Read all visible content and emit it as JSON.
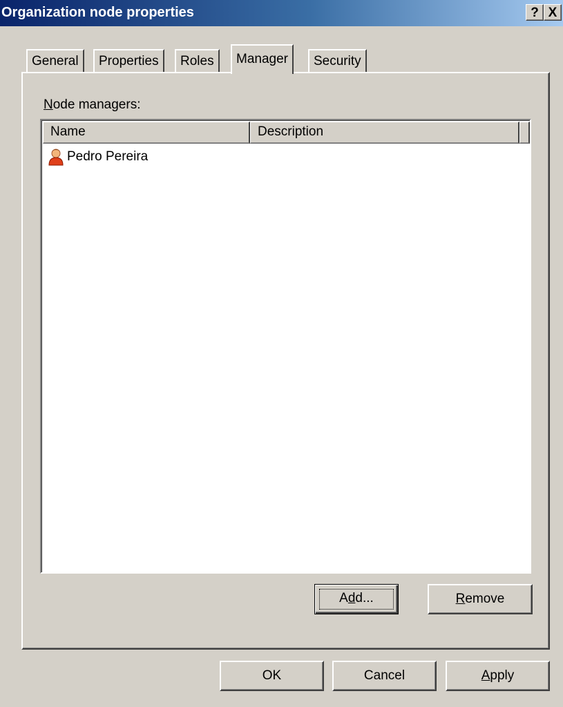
{
  "window": {
    "title": "Organization node properties",
    "help_label": "?",
    "close_label": "X"
  },
  "tabs": [
    {
      "label": "General",
      "active": false
    },
    {
      "label": "Properties",
      "active": false
    },
    {
      "label": "Roles",
      "active": false
    },
    {
      "label": "Manager",
      "active": true
    },
    {
      "label": "Security",
      "active": false
    }
  ],
  "manager": {
    "list_label_mnemonic": "N",
    "list_label_rest": "ode managers:",
    "columns": [
      "Name",
      "Description"
    ],
    "rows": [
      {
        "name": "Pedro Pereira",
        "description": "",
        "icon": "user-icon"
      }
    ],
    "add": {
      "pre": "A",
      "mnemonic": "d",
      "post": "d..."
    },
    "remove": {
      "mnemonic": "R",
      "post": "emove"
    }
  },
  "footer": {
    "ok_label": "OK",
    "cancel_label": "Cancel",
    "apply_mnemonic": "A",
    "apply_rest": "pply"
  },
  "colors": {
    "title_start": "#0a246a",
    "title_end": "#a6caf0",
    "face": "#d4d0c8"
  }
}
